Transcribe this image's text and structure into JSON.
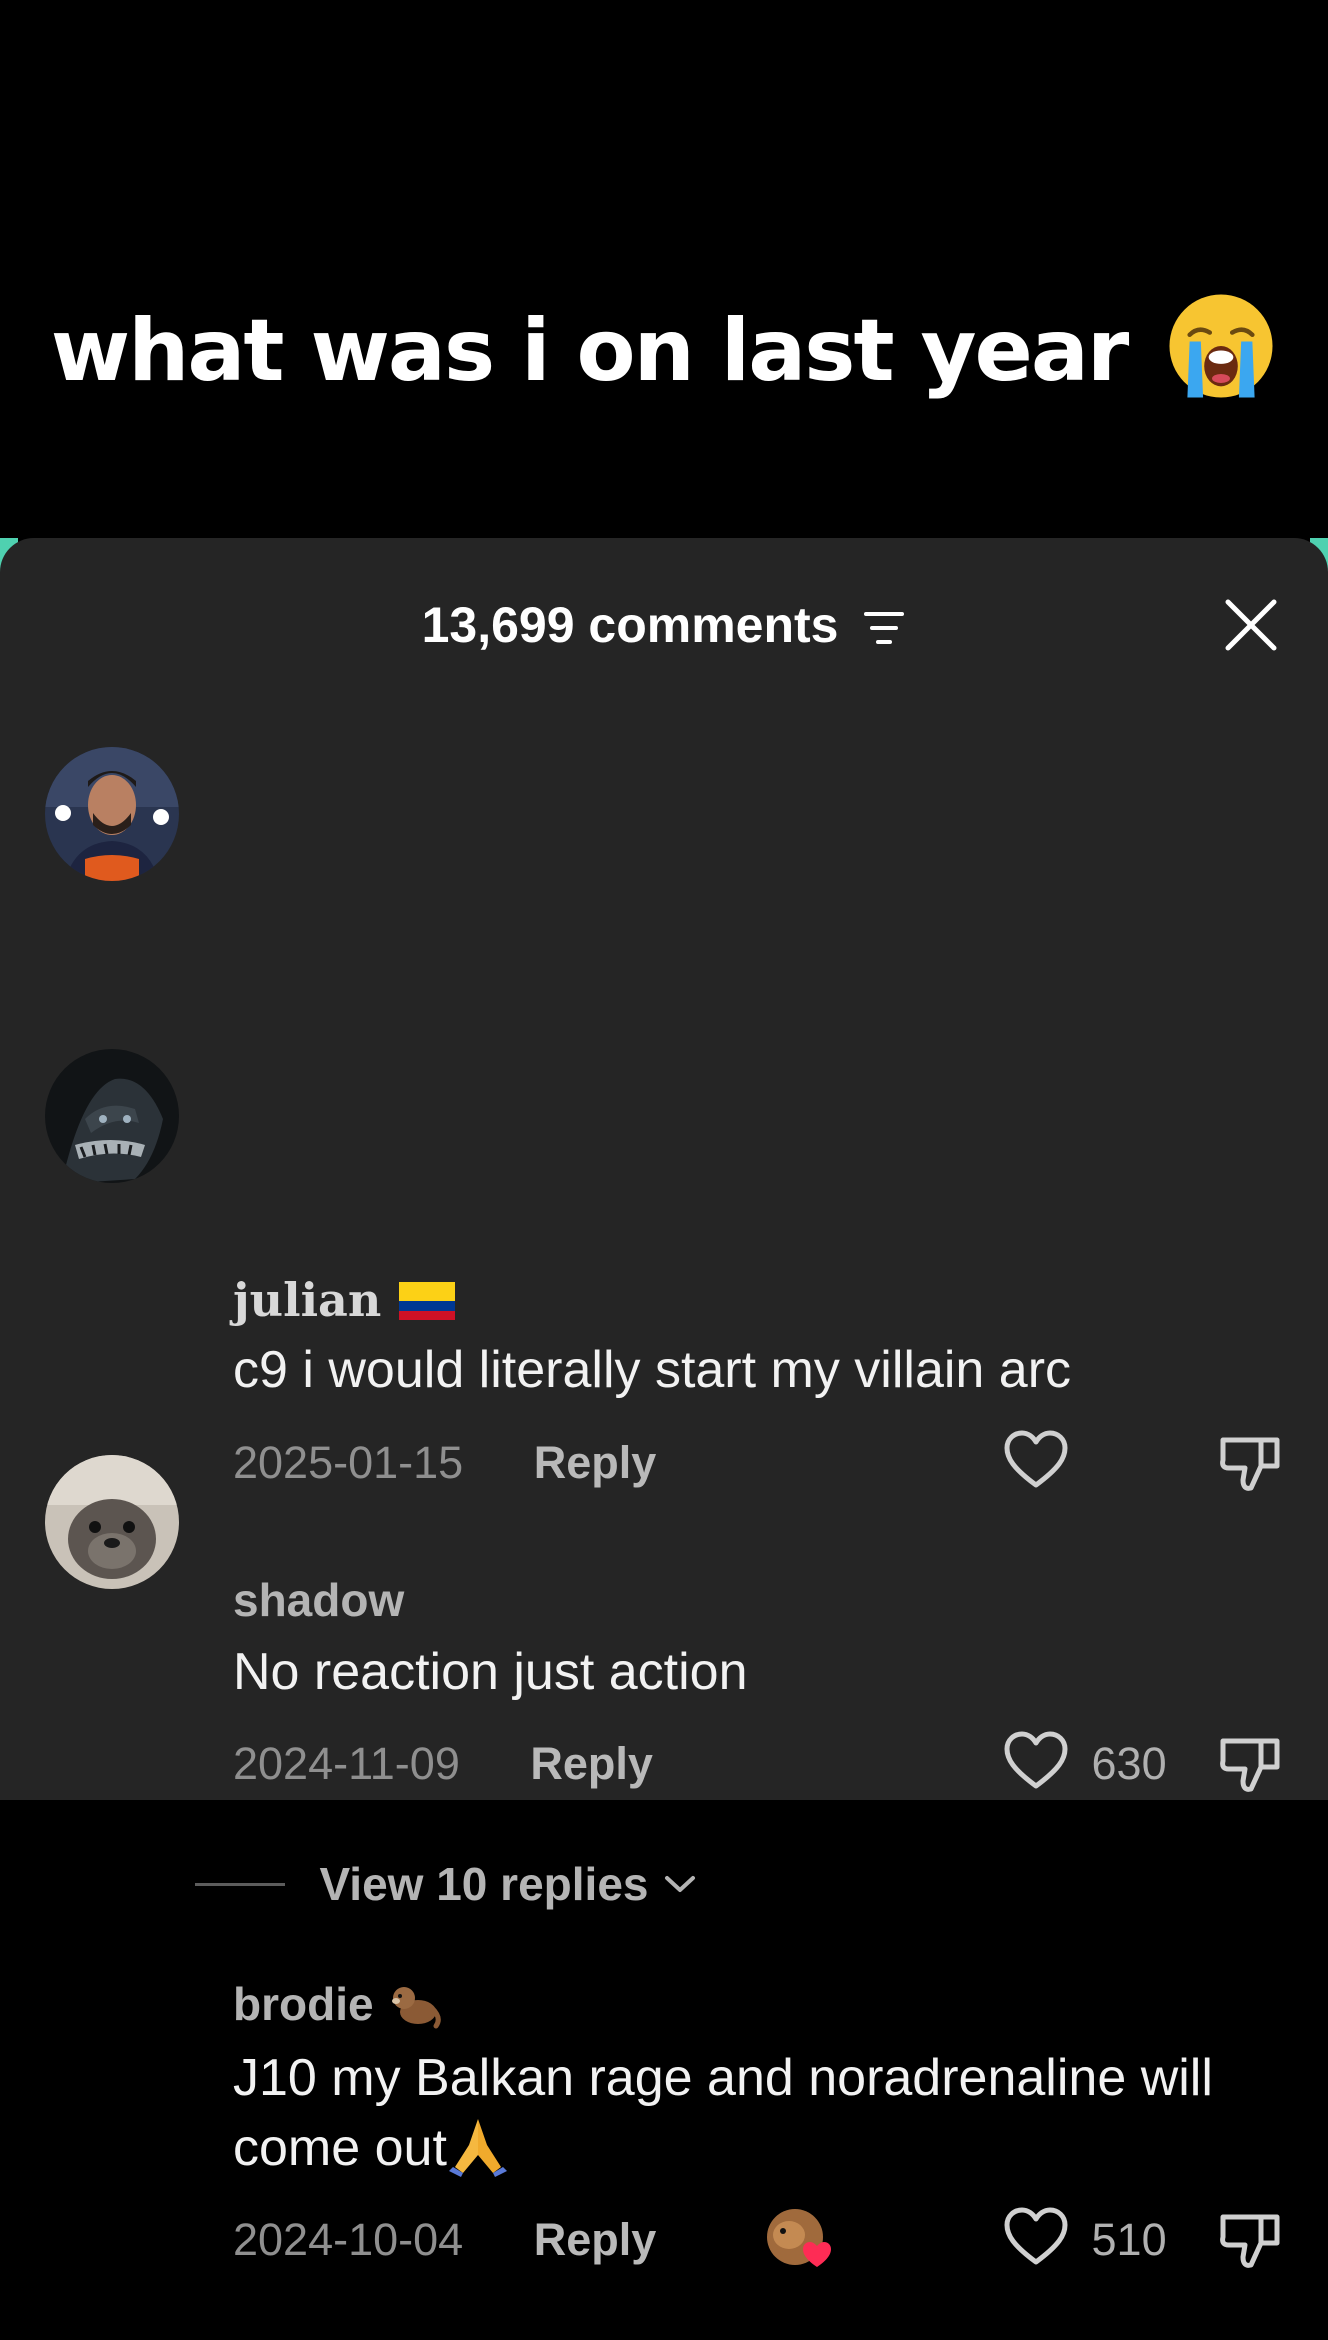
{
  "caption": {
    "text": "what was i on last year",
    "emoji": "loudly-crying-face-icon"
  },
  "sheet": {
    "comment_count_label": "13,699 comments",
    "filter_icon": "filter-icon",
    "close_icon": "close-icon"
  },
  "comments": [
    {
      "username": "julian",
      "username_emoji": "colombia-flag-icon",
      "text": "c9 i would literally start my villain arc",
      "date": "2025-01-15",
      "reply_label": "Reply",
      "likes": ""
    },
    {
      "username": "shadow",
      "text": "No reaction just action",
      "date": "2024-11-09",
      "reply_label": "Reply",
      "likes": "630",
      "view_replies_label": "View 10 replies"
    },
    {
      "username": "brodie",
      "username_emoji": "otter-icon",
      "text": "J10 my Balkan rage and noradrenaline will come out",
      "text_emoji": "folded-hands-icon",
      "date": "2024-10-04",
      "reply_label": "Reply",
      "likes": "510",
      "creator_liked_icon": "creator-liked-heart-icon"
    }
  ],
  "colors": {
    "background": "#000000",
    "sheet": "#252525",
    "primary_text": "#f2f2f2",
    "secondary_text": "#8f8f8f"
  }
}
